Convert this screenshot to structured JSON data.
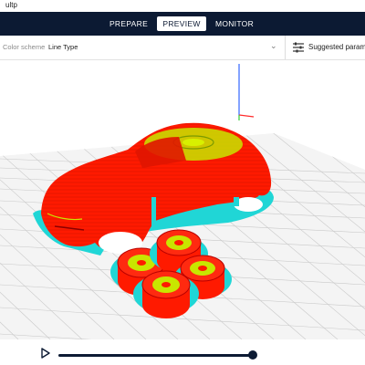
{
  "window": {
    "title": "ultp"
  },
  "tabs": {
    "prepare": "PREPARE",
    "preview": "PREVIEW",
    "monitor": "MONITOR",
    "active": "PREVIEW"
  },
  "toolbar": {
    "color_scheme_label": "Color scheme",
    "color_scheme_value": "Line Type",
    "color_scheme_chevron_icon": "chevron-down-icon",
    "suggested_label": "Suggested paramet...",
    "suggested_icon": "sliders-icon"
  },
  "viewport": {
    "colors": {
      "model": "#ff1a00",
      "infill": "#c8e600",
      "support": "#20d6d6",
      "grid": "#c9c9c9",
      "axis_x": "#ff2a2a",
      "axis_y": "#33cc33",
      "axis_z": "#3366ff"
    }
  },
  "playback": {
    "play_icon": "play-icon",
    "progress": 1.0,
    "accent": "#0c1a33"
  }
}
